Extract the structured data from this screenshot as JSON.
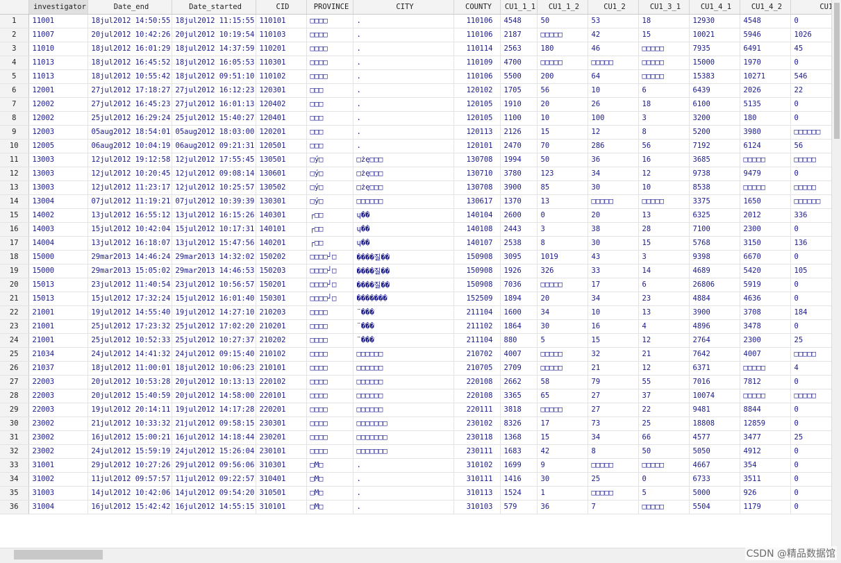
{
  "columns": [
    "investigator",
    "Date_end",
    "Date_started",
    "CID",
    "PROVINCE",
    "CITY",
    "COUNTY",
    "CU1_1_1",
    "CU1_1_2",
    "CU1_2",
    "CU1_3_1",
    "CU1_4_1",
    "CU1_4_2",
    "CU1_"
  ],
  "rows": [
    [
      "1",
      "11001",
      "18jul2012 14:50:55",
      "18jul2012 11:15:55",
      "110101",
      "□□□□",
      ".",
      "110106",
      "4548",
      "50",
      "53",
      "18",
      "12930",
      "4548",
      "0"
    ],
    [
      "2",
      "11007",
      "20jul2012 10:42:26",
      "20jul2012 10:19:54",
      "110103",
      "□□□□",
      ".",
      "110106",
      "2187",
      "□□□□□",
      "42",
      "15",
      "10021",
      "5946",
      "1026"
    ],
    [
      "3",
      "11010",
      "18jul2012 16:01:29",
      "18jul2012 14:37:59",
      "110201",
      "□□□□",
      ".",
      "110114",
      "2563",
      "180",
      "46",
      "□□□□□",
      "7935",
      "6491",
      "45"
    ],
    [
      "4",
      "11013",
      "18jul2012 16:45:52",
      "18jul2012 16:05:53",
      "110301",
      "□□□□",
      ".",
      "110109",
      "4700",
      "□□□□□",
      "□□□□□",
      "□□□□□",
      "15000",
      "1970",
      "0"
    ],
    [
      "5",
      "11013",
      "18jul2012 10:55:42",
      "18jul2012 09:51:10",
      "110102",
      "□□□□",
      ".",
      "110106",
      "5500",
      "200",
      "64",
      "□□□□□",
      "15383",
      "10271",
      "546"
    ],
    [
      "6",
      "12001",
      "27jul2012 17:18:27",
      "27jul2012 16:12:23",
      "120301",
      "□□□",
      ".",
      "120102",
      "1705",
      "56",
      "10",
      "6",
      "6439",
      "2026",
      "22"
    ],
    [
      "7",
      "12002",
      "27jul2012 16:45:23",
      "27jul2012 16:01:13",
      "120402",
      "□□□",
      ".",
      "120105",
      "1910",
      "20",
      "26",
      "18",
      "6100",
      "5135",
      "0"
    ],
    [
      "8",
      "12002",
      "25jul2012 16:29:24",
      "25jul2012 15:40:27",
      "120401",
      "□□□",
      ".",
      "120105",
      "1100",
      "10",
      "100",
      "3",
      "3200",
      "180",
      "0"
    ],
    [
      "9",
      "12003",
      "05aug2012 18:54:01",
      "05aug2012 18:03:00",
      "120201",
      "□□□",
      ".",
      "120113",
      "2126",
      "15",
      "12",
      "8",
      "5200",
      "3980",
      "□□□□□□"
    ],
    [
      "10",
      "12005",
      "06aug2012 10:04:19",
      "06aug2012 09:21:31",
      "120501",
      "□□□",
      ".",
      "120101",
      "2470",
      "70",
      "286",
      "56",
      "7192",
      "6124",
      "56"
    ],
    [
      "11",
      "13003",
      "12jul2012 19:12:58",
      "12jul2012 17:55:45",
      "130501",
      "□ý□",
      "□żę□□□",
      "130708",
      "1994",
      "50",
      "36",
      "16",
      "3685",
      "□□□□□",
      "□□□□□"
    ],
    [
      "12",
      "13003",
      "12jul2012 10:20:45",
      "12jul2012 09:08:14",
      "130601",
      "□ý□",
      "□żę□□□",
      "130710",
      "3780",
      "123",
      "34",
      "12",
      "9738",
      "9479",
      "0"
    ],
    [
      "13",
      "13003",
      "12jul2012 11:23:17",
      "12jul2012 10:25:57",
      "130502",
      "□ý□",
      "□żę□□□",
      "130708",
      "3900",
      "85",
      "30",
      "10",
      "8538",
      "□□□□□",
      "□□□□□"
    ],
    [
      "14",
      "13004",
      "07jul2012 11:19:21",
      "07jul2012 10:39:39",
      "130301",
      "□ý□",
      "□□□□□□",
      "130617",
      "1370",
      "13",
      "□□□□□",
      "□□□□□",
      "3375",
      "1650",
      "□□□□□□"
    ],
    [
      "15",
      "14002",
      "13jul2012 16:55:12",
      "13jul2012 16:15:26",
      "140301",
      "┌□□",
      "ɥ��",
      "140104",
      "2600",
      "0",
      "20",
      "13",
      "6325",
      "2012",
      "336"
    ],
    [
      "16",
      "14003",
      "15jul2012 10:42:04",
      "15jul2012 10:17:31",
      "140101",
      "┌□□",
      "ɥ��",
      "140108",
      "2443",
      "3",
      "38",
      "28",
      "7100",
      "2300",
      "0"
    ],
    [
      "17",
      "14004",
      "13jul2012 16:18:07",
      "13jul2012 15:47:56",
      "140201",
      "┌□□",
      "ɥ��",
      "140107",
      "2538",
      "8",
      "30",
      "15",
      "5768",
      "3150",
      "136"
    ],
    [
      "18",
      "15000",
      "29mar2013 14:46:24",
      "29mar2013 14:32:02",
      "150202",
      "□□□□┘□",
      "����질��",
      "150908",
      "3095",
      "1019",
      "43",
      "3",
      "9398",
      "6670",
      "0"
    ],
    [
      "19",
      "15000",
      "29mar2013 15:05:02",
      "29mar2013 14:46:53",
      "150203",
      "□□□□┘□",
      "����질��",
      "150908",
      "1926",
      "326",
      "33",
      "14",
      "4689",
      "5420",
      "105"
    ],
    [
      "20",
      "15013",
      "23jul2012 11:40:54",
      "23jul2012 10:56:57",
      "150201",
      "□□□□┘□",
      "����질��",
      "150908",
      "7036",
      "□□□□□",
      "17",
      "6",
      "26806",
      "5919",
      "0"
    ],
    [
      "21",
      "15013",
      "15jul2012 17:32:24",
      "15jul2012 16:01:40",
      "150301",
      "□□□□┘□",
      "�������",
      "152509",
      "1894",
      "20",
      "34",
      "23",
      "4884",
      "4636",
      "0"
    ],
    [
      "22",
      "21001",
      "19jul2012 14:55:40",
      "19jul2012 14:27:10",
      "210203",
      "□□□□",
      "¨���",
      "211104",
      "1600",
      "34",
      "10",
      "13",
      "3900",
      "3708",
      "184"
    ],
    [
      "23",
      "21001",
      "25jul2012 17:23:32",
      "25jul2012 17:02:20",
      "210201",
      "□□□□",
      "¨���",
      "211102",
      "1864",
      "30",
      "16",
      "4",
      "4896",
      "3478",
      "0"
    ],
    [
      "24",
      "21001",
      "25jul2012 10:52:33",
      "25jul2012 10:27:37",
      "210202",
      "□□□□",
      "¨���",
      "211104",
      "880",
      "5",
      "15",
      "12",
      "2764",
      "2300",
      "25"
    ],
    [
      "25",
      "21034",
      "24jul2012 14:41:32",
      "24jul2012 09:15:40",
      "210102",
      "□□□□",
      "□□□□□□",
      "210702",
      "4007",
      "□□□□□",
      "32",
      "21",
      "7642",
      "4007",
      "□□□□□"
    ],
    [
      "26",
      "21037",
      "18jul2012 11:00:01",
      "18jul2012 10:06:23",
      "210101",
      "□□□□",
      "□□□□□□",
      "210705",
      "2709",
      "□□□□□",
      "21",
      "12",
      "6371",
      "□□□□□",
      "4"
    ],
    [
      "27",
      "22003",
      "20jul2012 10:53:28",
      "20jul2012 10:13:13",
      "220102",
      "□□□□",
      "□□□□□□",
      "220108",
      "2662",
      "58",
      "79",
      "55",
      "7016",
      "7812",
      "0"
    ],
    [
      "28",
      "22003",
      "20jul2012 15:40:59",
      "20jul2012 14:58:00",
      "220101",
      "□□□□",
      "□□□□□□",
      "220108",
      "3365",
      "65",
      "27",
      "37",
      "10074",
      "□□□□□",
      "□□□□□"
    ],
    [
      "29",
      "22003",
      "19jul2012 20:14:11",
      "19jul2012 14:17:28",
      "220201",
      "□□□□",
      "□□□□□□",
      "220111",
      "3818",
      "□□□□□",
      "27",
      "22",
      "9481",
      "8844",
      "0"
    ],
    [
      "30",
      "23002",
      "21jul2012 10:33:32",
      "21jul2012 09:58:15",
      "230301",
      "□□□□",
      "□□□□□□□",
      "230102",
      "8326",
      "17",
      "73",
      "25",
      "18808",
      "12859",
      "0"
    ],
    [
      "31",
      "23002",
      "16jul2012 15:00:21",
      "16jul2012 14:18:44",
      "230201",
      "□□□□",
      "□□□□□□□",
      "230118",
      "1368",
      "15",
      "34",
      "66",
      "4577",
      "3477",
      "25"
    ],
    [
      "32",
      "23002",
      "24jul2012 15:59:19",
      "24jul2012 15:26:04",
      "230101",
      "□□□□",
      "□□□□□□□",
      "230111",
      "1683",
      "42",
      "8",
      "50",
      "5050",
      "4912",
      "0"
    ],
    [
      "33",
      "31001",
      "29jul2012 10:27:26",
      "29jul2012 09:56:06",
      "310301",
      "□M□",
      ".",
      "310102",
      "1699",
      "9",
      "□□□□□",
      "□□□□□",
      "4667",
      "354",
      "0"
    ],
    [
      "34",
      "31002",
      "11jul2012 09:57:57",
      "11jul2012 09:22:57",
      "310401",
      "□M□",
      ".",
      "310111",
      "1416",
      "30",
      "25",
      "0",
      "6733",
      "3511",
      "0"
    ],
    [
      "35",
      "31003",
      "14jul2012 10:42:06",
      "14jul2012 09:54:20",
      "310501",
      "□M□",
      ".",
      "310113",
      "1524",
      "1",
      "□□□□□",
      "5",
      "5000",
      "926",
      "0"
    ],
    [
      "36",
      "31004",
      "16jul2012 15:42:42",
      "16jul2012 14:55:15",
      "310101",
      "□M□",
      ".",
      "310103",
      "579",
      "36",
      "7",
      "□□□□□",
      "5504",
      "1179",
      "0"
    ]
  ],
  "watermark": "CSDN @精品数据馆",
  "colors": {
    "cell_text": "#1a1a8c",
    "header_bg": "#f3f3f3",
    "grid_line": "#e3e3e3"
  }
}
